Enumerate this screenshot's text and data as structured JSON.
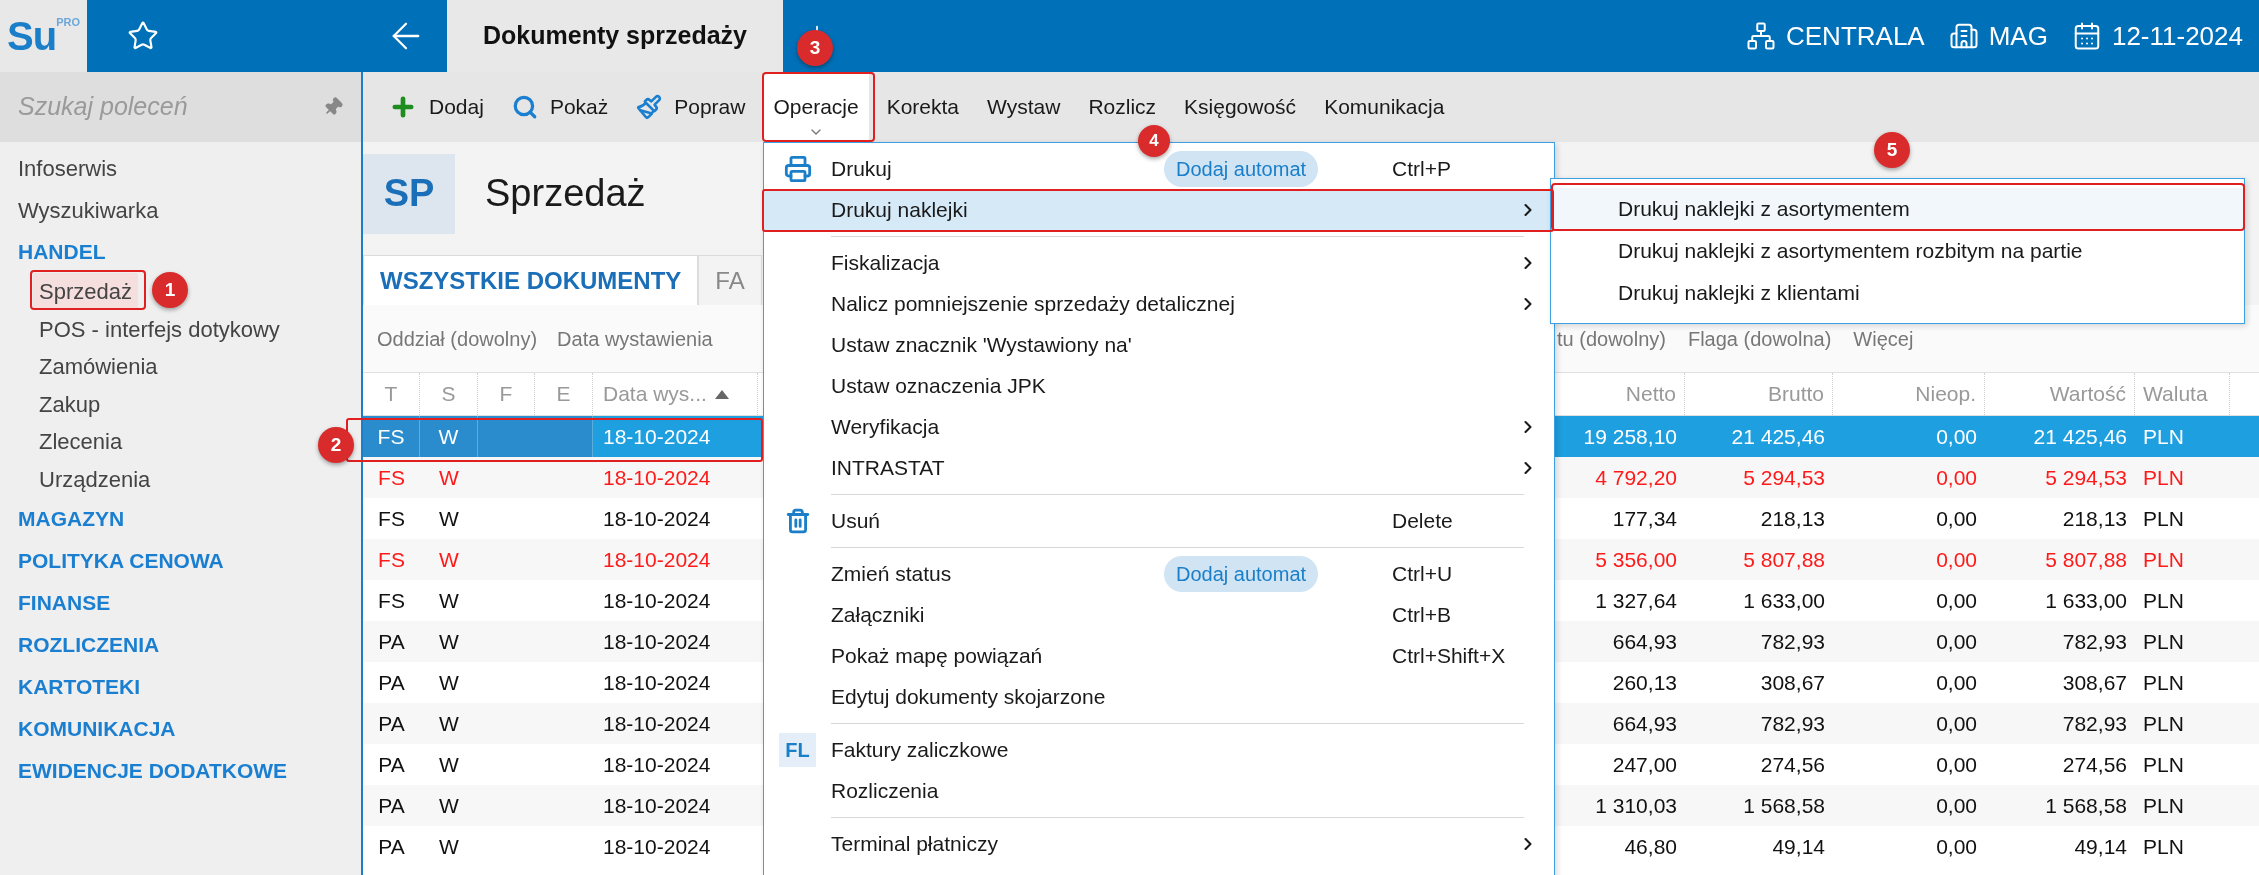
{
  "logo": {
    "text": "Su",
    "sup": "PRO"
  },
  "window": {
    "tab": "Dokumenty sprzedaży"
  },
  "status": [
    {
      "kind": "branch",
      "label": "CENTRALA"
    },
    {
      "kind": "store",
      "label": "MAG"
    },
    {
      "kind": "date",
      "label": "12-11-2024"
    }
  ],
  "sidebar": {
    "search": {
      "placeholder": "Szukaj poleceń"
    },
    "items": [
      {
        "kind": "link",
        "label": "Infoserwis",
        "selected": false
      },
      {
        "kind": "link",
        "label": "Wyszukiwarka",
        "selected": false
      },
      {
        "kind": "section",
        "label": "HANDEL",
        "selected": false,
        "children": [
          {
            "label": "Sprzedaż",
            "selected": true
          },
          {
            "label": "POS - interfejs dotykowy",
            "selected": false
          },
          {
            "label": "Zamówienia",
            "selected": false
          },
          {
            "label": "Zakup",
            "selected": false
          },
          {
            "label": "Zlecenia",
            "selected": false
          },
          {
            "label": "Urządzenia",
            "selected": false
          }
        ]
      },
      {
        "kind": "section",
        "label": "MAGAZYN",
        "selected": false
      },
      {
        "kind": "section",
        "label": "POLITYKA CENOWA",
        "selected": false
      },
      {
        "kind": "section",
        "label": "FINANSE",
        "selected": false
      },
      {
        "kind": "section",
        "label": "ROZLICZENIA",
        "selected": false
      },
      {
        "kind": "section",
        "label": "KARTOTEKI",
        "selected": false
      },
      {
        "kind": "section",
        "label": "KOMUNIKACJA",
        "selected": false
      },
      {
        "kind": "section",
        "label": "EWIDENCJE DODATKOWE",
        "selected": false
      }
    ]
  },
  "toolbar": [
    {
      "kind": "add",
      "label": "Dodaj",
      "selected": false
    },
    {
      "kind": "view",
      "label": "Pokaż",
      "selected": false
    },
    {
      "kind": "edit",
      "label": "Popraw",
      "selected": false
    },
    {
      "kind": "plain",
      "label": "Operacje",
      "selected": true
    },
    {
      "kind": "plain",
      "label": "Korekta",
      "selected": false
    },
    {
      "kind": "plain",
      "label": "Wystaw",
      "selected": false
    },
    {
      "kind": "plain",
      "label": "Rozlicz",
      "selected": false
    },
    {
      "kind": "plain",
      "label": "Księgowość",
      "selected": false
    },
    {
      "kind": "plain",
      "label": "Komunikacja",
      "selected": false
    }
  ],
  "header": {
    "code": "SP",
    "title": "Sprzedaż"
  },
  "tabs": [
    {
      "label": "WSZYSTKIE DOKUMENTY",
      "selected": true
    },
    {
      "label": "FA",
      "selected": false
    }
  ],
  "filters": {
    "left": [
      "Oddział (dowolny)",
      "Data wystawienia"
    ],
    "right": [
      "tu (dowolny)",
      "Flaga (dowolna)",
      "Więcej"
    ]
  },
  "table": {
    "columns_left": [
      "T",
      "S",
      "F",
      "E",
      "Data wys..."
    ],
    "columns_right": [
      "Netto",
      "Brutto",
      "Nieop.",
      "Wartość",
      "Waluta"
    ],
    "rows": [
      {
        "t": "FS",
        "s": "W",
        "date": "18-10-2024",
        "netto": "19 258,10",
        "brutto": "21 425,46",
        "nieop": "0,00",
        "wartosc": "21 425,46",
        "waluta": "PLN",
        "selected": true,
        "flagged": false
      },
      {
        "t": "FS",
        "s": "W",
        "date": "18-10-2024",
        "netto": "4 792,20",
        "brutto": "5 294,53",
        "nieop": "0,00",
        "wartosc": "5 294,53",
        "waluta": "PLN",
        "selected": false,
        "flagged": true
      },
      {
        "t": "FS",
        "s": "W",
        "date": "18-10-2024",
        "netto": "177,34",
        "brutto": "218,13",
        "nieop": "0,00",
        "wartosc": "218,13",
        "waluta": "PLN",
        "selected": false,
        "flagged": false
      },
      {
        "t": "FS",
        "s": "W",
        "date": "18-10-2024",
        "netto": "5 356,00",
        "brutto": "5 807,88",
        "nieop": "0,00",
        "wartosc": "5 807,88",
        "waluta": "PLN",
        "selected": false,
        "flagged": true
      },
      {
        "t": "FS",
        "s": "W",
        "date": "18-10-2024",
        "netto": "1 327,64",
        "brutto": "1 633,00",
        "nieop": "0,00",
        "wartosc": "1 633,00",
        "waluta": "PLN",
        "selected": false,
        "flagged": false
      },
      {
        "t": "PA",
        "s": "W",
        "date": "18-10-2024",
        "netto": "664,93",
        "brutto": "782,93",
        "nieop": "0,00",
        "wartosc": "782,93",
        "waluta": "PLN",
        "selected": false,
        "flagged": false
      },
      {
        "t": "PA",
        "s": "W",
        "date": "18-10-2024",
        "netto": "260,13",
        "brutto": "308,67",
        "nieop": "0,00",
        "wartosc": "308,67",
        "waluta": "PLN",
        "selected": false,
        "flagged": false
      },
      {
        "t": "PA",
        "s": "W",
        "date": "18-10-2024",
        "netto": "664,93",
        "brutto": "782,93",
        "nieop": "0,00",
        "wartosc": "782,93",
        "waluta": "PLN",
        "selected": false,
        "flagged": false
      },
      {
        "t": "PA",
        "s": "W",
        "date": "18-10-2024",
        "netto": "247,00",
        "brutto": "274,56",
        "nieop": "0,00",
        "wartosc": "274,56",
        "waluta": "PLN",
        "selected": false,
        "flagged": false
      },
      {
        "t": "PA",
        "s": "W",
        "date": "18-10-2024",
        "netto": "1 310,03",
        "brutto": "1 568,58",
        "nieop": "0,00",
        "wartosc": "1 568,58",
        "waluta": "PLN",
        "selected": false,
        "flagged": false
      },
      {
        "t": "PA",
        "s": "W",
        "date": "18-10-2024",
        "netto": "46,80",
        "brutto": "49,14",
        "nieop": "0,00",
        "wartosc": "49,14",
        "waluta": "PLN",
        "selected": false,
        "flagged": false
      }
    ]
  },
  "menu": [
    {
      "kind": "printer",
      "label": "Drukuj",
      "automat": "Dodaj automat",
      "shortcut": "Ctrl+P",
      "selected": false
    },
    {
      "kind": "plain",
      "label": "Drukuj naklejki",
      "submenu": true,
      "selected": true
    },
    {
      "kind": "separator"
    },
    {
      "kind": "plain",
      "label": "Fiskalizacja",
      "submenu": true,
      "selected": false
    },
    {
      "kind": "plain",
      "label": "Nalicz pomniejszenie sprzedaży detalicznej",
      "submenu": true,
      "selected": false
    },
    {
      "kind": "plain",
      "label": "Ustaw znacznik 'Wystawiony na'",
      "selected": false
    },
    {
      "kind": "plain",
      "label": "Ustaw oznaczenia JPK",
      "selected": false
    },
    {
      "kind": "plain",
      "label": "Weryfikacja",
      "submenu": true,
      "selected": false
    },
    {
      "kind": "plain",
      "label": "INTRASTAT",
      "submenu": true,
      "selected": false
    },
    {
      "kind": "separator"
    },
    {
      "kind": "trash",
      "label": "Usuń",
      "shortcut": "Delete",
      "selected": false
    },
    {
      "kind": "separator"
    },
    {
      "kind": "plain",
      "label": "Zmień status",
      "automat": "Dodaj automat",
      "shortcut": "Ctrl+U",
      "selected": false
    },
    {
      "kind": "plain",
      "label": "Załączniki",
      "shortcut": "Ctrl+B",
      "selected": false
    },
    {
      "kind": "plain",
      "label": "Pokaż mapę powiązań",
      "shortcut": "Ctrl+Shift+X",
      "selected": false
    },
    {
      "kind": "plain",
      "label": "Edytuj dokumenty skojarzone",
      "selected": false
    },
    {
      "kind": "separator"
    },
    {
      "kind": "code",
      "code": "FL",
      "label": "Faktury zaliczkowe",
      "selected": false
    },
    {
      "kind": "plain",
      "label": "Rozliczenia",
      "selected": false
    },
    {
      "kind": "separator"
    },
    {
      "kind": "plain",
      "label": "Terminal płatniczy",
      "submenu": true,
      "selected": false
    }
  ],
  "submenu": [
    {
      "label": "Drukuj naklejki z asortymentem",
      "selected": true
    },
    {
      "label": "Drukuj naklejki z asortymentem rozbitym na partie",
      "selected": false
    },
    {
      "label": "Drukuj naklejki z klientami",
      "selected": false
    }
  ],
  "annotations": [
    "1",
    "2",
    "3",
    "4",
    "5"
  ]
}
